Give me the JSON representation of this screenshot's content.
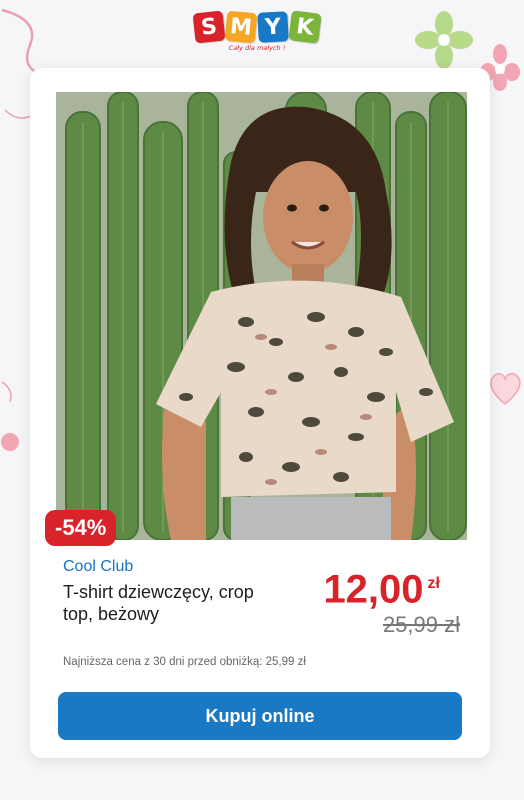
{
  "logo": {
    "letters": [
      "S",
      "M",
      "Y",
      "K"
    ],
    "colors": [
      "#d8232a",
      "#f5a623",
      "#1a79c4",
      "#7bb53b"
    ],
    "tagline": "Cały dla małych !"
  },
  "product": {
    "image": "girl-in-leopard-print-crop-top-among-cacti",
    "discount_badge": "-54%",
    "brand": "Cool Club",
    "name": "T-shirt dziewczęcy, crop top, beżowy",
    "price_new": "12,00",
    "currency": "zł",
    "price_old": "25,99 zł",
    "lowest_price_note": "Najniższa cena z 30 dni przed obniżką: 25,99 zł"
  },
  "actions": {
    "buy_label": "Kupuj online"
  },
  "colors": {
    "accent_red": "#d8232a",
    "brand_blue": "#1a72c4",
    "button_blue": "#1a79c4"
  }
}
